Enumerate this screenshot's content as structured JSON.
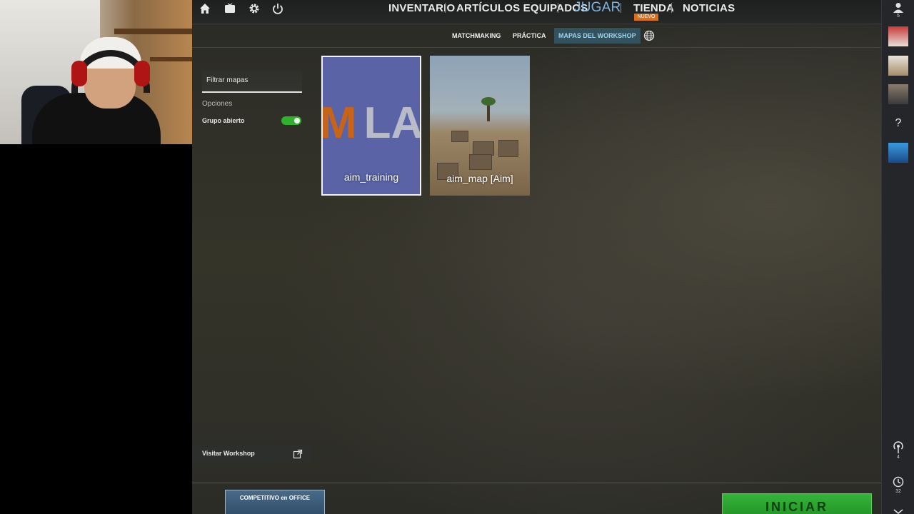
{
  "nav": {
    "inventory": "INVENTARIO",
    "equipped": "ARTÍCULOS EQUIPADOS",
    "play": "JUGAR",
    "store": "TIENDA",
    "store_badge": "NUEVO",
    "news": "NOTICIAS"
  },
  "subnav": {
    "matchmaking": "MATCHMAKING",
    "practice": "PRÁCTICA",
    "workshop_maps": "MAPAS DEL WORKSHOP"
  },
  "filter": {
    "placeholder": "Filtrar mapas"
  },
  "options": {
    "label": "Opciones",
    "open_group_label": "Grupo abierto",
    "open_group_enabled": true
  },
  "maps": [
    {
      "name": "aim_training",
      "art_text_1": "M",
      "art_text_2": "LA"
    },
    {
      "name": "aim_map [Aim]"
    }
  ],
  "visit_workshop_label": "Visitar Workshop",
  "promo": {
    "title": "COMPETITIVO en OFFICE"
  },
  "start_label": "INICIAR",
  "sidebar": {
    "friends_count": "5",
    "help": "?",
    "signal_count": "4",
    "history_count": "32"
  },
  "colors": {
    "active_blue": "#7ab7e8",
    "badge_orange": "#d8701b",
    "toggle_green": "#2fb32f",
    "start_green": "#36b43a"
  }
}
